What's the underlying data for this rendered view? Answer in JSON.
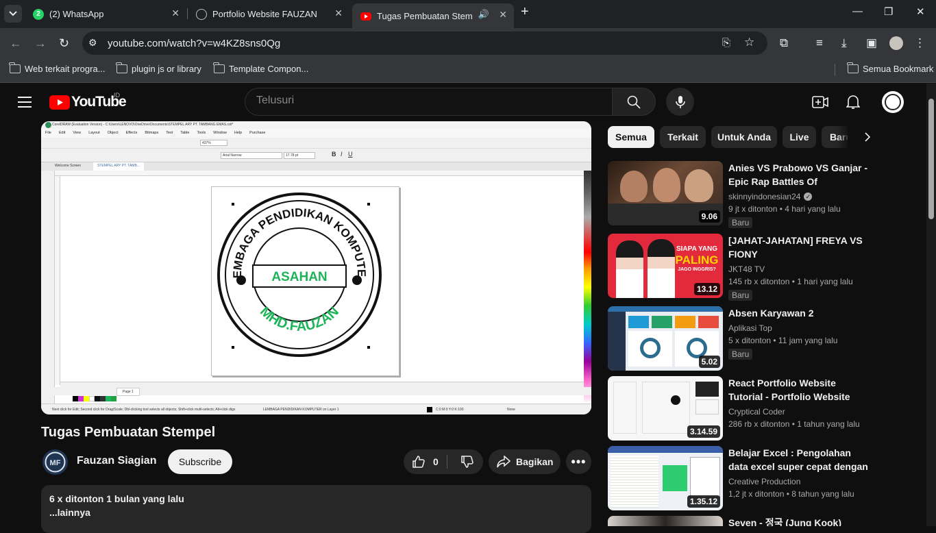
{
  "browser": {
    "tabs": [
      {
        "label": "(2) WhatsApp",
        "badge": "2"
      },
      {
        "label": "Portfolio Website FAUZAN"
      },
      {
        "label": "Tugas Pembuatan Stempel"
      }
    ],
    "url": "youtube.com/watch?v=w4KZ8sns0Qg",
    "bookmarks": [
      "Web terkait progra...",
      "plugin js or library",
      "Template Compon..."
    ],
    "all_bookmarks": "Semua Bookmark"
  },
  "youtube": {
    "logo_text": "YouTube",
    "region": "ID",
    "search_placeholder": "Telusuri"
  },
  "video": {
    "title": "Tugas Pembuatan Stempel",
    "channel": "Fauzan Siagian",
    "subscribe_label": "Subscribe",
    "likes": "0",
    "share_label": "Bagikan",
    "views_date": "6 x ditonton  1 bulan yang lalu",
    "more_label": "...lainnya",
    "screen": {
      "app_title": "CorelDRAW (Evaluation Version) - C:\\Users\\LENOVO\\OneDrive\\Documents\\STEMPEL ARY PT. TAMBANG EMAS.cdr*",
      "menus": [
        "File",
        "Edit",
        "View",
        "Layout",
        "Object",
        "Effects",
        "Bitmaps",
        "Text",
        "Table",
        "Tools",
        "Window",
        "Help",
        "Purchase"
      ],
      "doc_tabs": [
        "Welcome Screen",
        "STEMPEL ARY PT. TAMB..."
      ],
      "zoom": "437%",
      "font": "Arial Narrow",
      "font_size": "17.78 pt",
      "stamp_top_text": "LEMBAGA PENDIDIKAN KOMPUTER",
      "stamp_center_text": "ASAHAN",
      "stamp_bottom_text": "MHD.FAUZAN",
      "page_tab": "Page 1",
      "status_left": "Next click for Edit; Second click for Drag/Scale; Dbl-clicking tool selects all objects; Shift+click multi-selects; Alt+click digs",
      "status_mid": "LEMBAGA PENDIDIKAN KOMPUTER on Layer 1",
      "status_color": "C:0 M:0 Y:0 K:100",
      "status_none": "None"
    }
  },
  "chips": [
    "Semua",
    "Terkait",
    "Untuk Anda",
    "Live",
    "Baru"
  ],
  "recommendations": [
    {
      "title": "Anies VS Prabowo VS Ganjar - Epic Rap Battles Of Presidenc...",
      "channel": "skinnyindonesian24",
      "verified": true,
      "stats": "9 jt x ditonton  • 4 hari yang lalu",
      "badge": "Baru",
      "duration": "9.06"
    },
    {
      "title": "[JAHAT-JAHATAN] FREYA VS FIONY",
      "channel": "JKT48 TV",
      "stats": "145 rb x ditonton  • 1 hari yang lalu",
      "badge": "Baru",
      "duration": "13.12",
      "thumb_text_1": "SIAPA YANG",
      "thumb_text_2": "PALING",
      "thumb_text_3": "JAGO INGGRIS?"
    },
    {
      "title": "Absen Karyawan 2",
      "channel": "Aplikasi Top",
      "stats": "5 x ditonton  • 11 jam yang lalu",
      "badge": "Baru",
      "duration": "5.02"
    },
    {
      "title": "React Portfolio Website Tutorial - Portfolio Website Using Reac...",
      "channel": "Cryptical Coder",
      "stats": "286 rb x ditonton  • 1 tahun yang lalu",
      "duration": "3.14.59"
    },
    {
      "title": "Belajar Excel : Pengolahan data excel super cepat dengan Pivot",
      "channel": "Creative Production",
      "stats": "1,2 jt x ditonton  • 8 tahun yang lalu",
      "duration": "1.35.12"
    },
    {
      "title": "Seven - 정국 (Jung Kook)"
    }
  ]
}
